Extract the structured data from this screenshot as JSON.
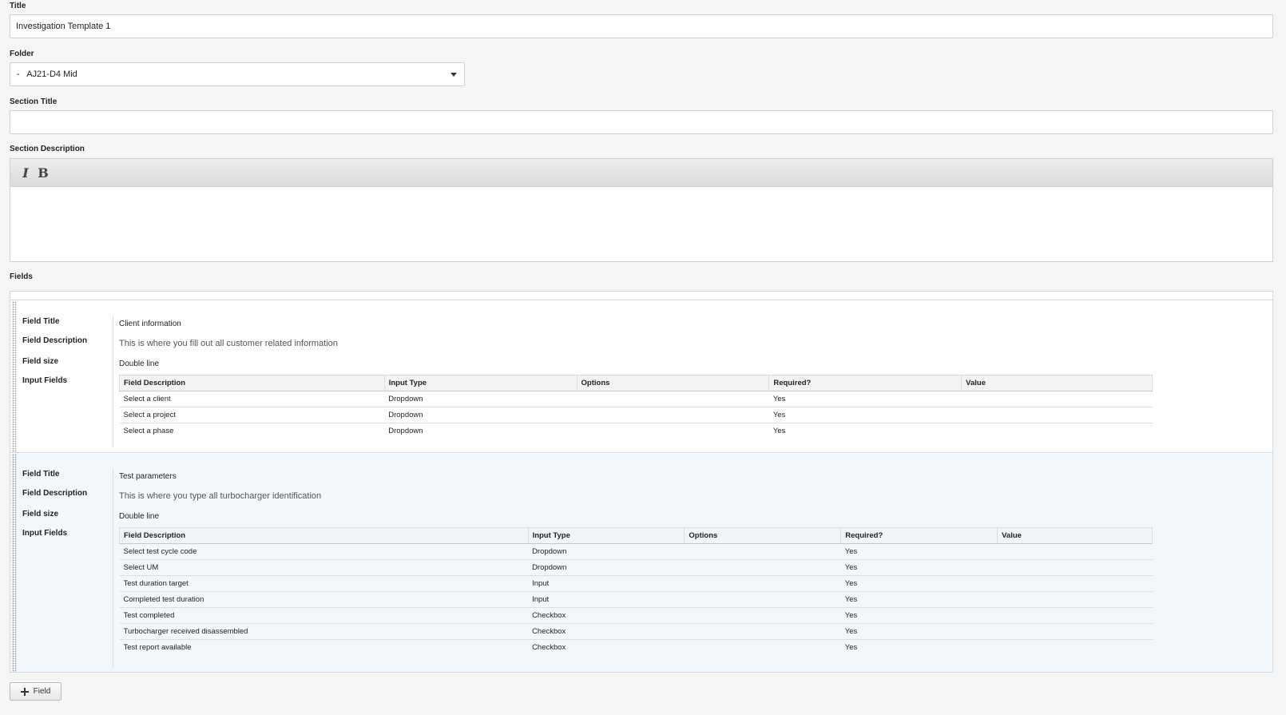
{
  "title": {
    "label": "Title",
    "value": "Investigation Template 1"
  },
  "folder": {
    "label": "Folder",
    "value": "-   AJ21-D4 Mid"
  },
  "section_title": {
    "label": "Section Title",
    "value": ""
  },
  "section_description": {
    "label": "Section Description",
    "toolbar": {
      "italic": "I",
      "bold": "B"
    },
    "value": ""
  },
  "fields_label": "Fields",
  "meta_labels": {
    "title": "Field Title",
    "description": "Field Description",
    "size": "Field size",
    "inputs": "Input Fields"
  },
  "table_headers": [
    "Field Description",
    "Input Type",
    "Options",
    "Required?",
    "Value"
  ],
  "fields": [
    {
      "title": "Client information",
      "description": "This is where you fill out all customer related information",
      "size": "Double line",
      "rows": [
        [
          "Select a client",
          "Dropdown",
          "",
          "Yes",
          ""
        ],
        [
          "Select a project",
          "Dropdown",
          "",
          "Yes",
          ""
        ],
        [
          "Select a phase",
          "Dropdown",
          "",
          "Yes",
          ""
        ]
      ]
    },
    {
      "title": "Test parameters",
      "description": "This is where you type all turbocharger identification",
      "size": "Double line",
      "rows": [
        [
          "Select test cycle code",
          "Dropdown",
          "",
          "Yes",
          ""
        ],
        [
          "Select UM",
          "Dropdown",
          "",
          "Yes",
          ""
        ],
        [
          "Test duration target",
          "Input",
          "",
          "Yes",
          ""
        ],
        [
          "Completed test duration",
          "Input",
          "",
          "Yes",
          ""
        ],
        [
          "Test completed",
          "Checkbox",
          "",
          "Yes",
          ""
        ],
        [
          "Turbocharger received disassembled",
          "Checkbox",
          "",
          "Yes",
          ""
        ],
        [
          "Test report available",
          "Checkbox",
          "",
          "Yes",
          ""
        ]
      ]
    }
  ],
  "add_field_button": "Field"
}
